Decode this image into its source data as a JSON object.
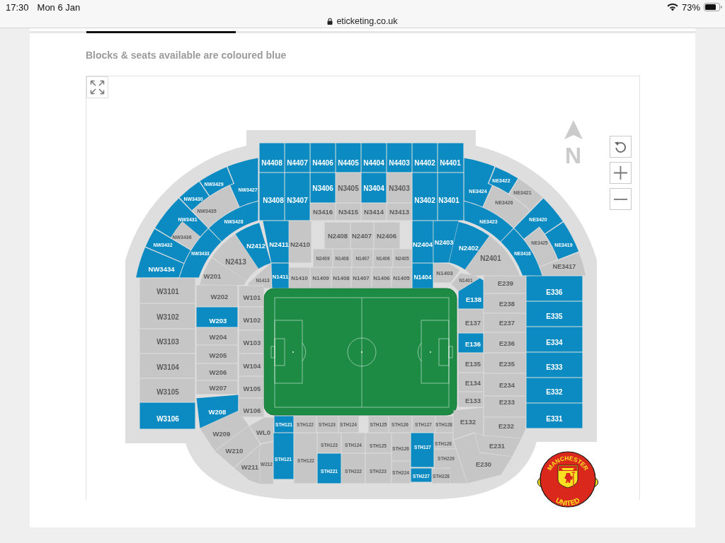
{
  "status_bar": {
    "time": "17:30",
    "date": "Mon 6 Jan",
    "battery": "73%"
  },
  "address_bar": {
    "url": "eticketing.co.uk"
  },
  "hint": "Blocks & seats available are coloured blue",
  "map": {
    "compass": "N",
    "blocks": [
      {
        "label": "N4408",
        "available": true
      },
      {
        "label": "N4407",
        "available": true
      },
      {
        "label": "N4406",
        "available": true
      },
      {
        "label": "N4405",
        "available": true
      },
      {
        "label": "N4404",
        "available": true
      },
      {
        "label": "N4403",
        "available": true
      },
      {
        "label": "N4402",
        "available": true
      },
      {
        "label": "N4401",
        "available": true
      },
      {
        "label": "NW3429",
        "available": true
      },
      {
        "label": "NE3422",
        "available": true
      },
      {
        "label": "NW3427",
        "available": true
      },
      {
        "label": "N3406",
        "available": true
      },
      {
        "label": "N3405",
        "available": false
      },
      {
        "label": "N3404",
        "available": true
      },
      {
        "label": "N3403",
        "available": false
      },
      {
        "label": "NE3424",
        "available": true
      },
      {
        "label": "NE3421",
        "available": false
      },
      {
        "label": "NW3430",
        "available": true
      },
      {
        "label": "N3408",
        "available": true
      },
      {
        "label": "N3407",
        "available": true
      },
      {
        "label": "N3402",
        "available": true
      },
      {
        "label": "N3401",
        "available": true
      },
      {
        "label": "NE3426",
        "available": false
      },
      {
        "label": "NW3435",
        "available": false
      },
      {
        "label": "N3416",
        "available": false
      },
      {
        "label": "N3415",
        "available": false
      },
      {
        "label": "N3414",
        "available": false
      },
      {
        "label": "N3413",
        "available": false
      },
      {
        "label": "NW3431",
        "available": true
      },
      {
        "label": "NW3428",
        "available": true
      },
      {
        "label": "NE3423",
        "available": true
      },
      {
        "label": "NE3420",
        "available": true
      },
      {
        "label": "NW3436",
        "available": false
      },
      {
        "label": "N2408",
        "available": false
      },
      {
        "label": "N2407",
        "available": false
      },
      {
        "label": "N2406",
        "available": false
      },
      {
        "label": "NW3432",
        "available": true
      },
      {
        "label": "N2412",
        "available": true
      },
      {
        "label": "N2411",
        "available": true
      },
      {
        "label": "N2410",
        "available": false
      },
      {
        "label": "N2404",
        "available": true
      },
      {
        "label": "N2403",
        "available": true
      },
      {
        "label": "N2402",
        "available": true
      },
      {
        "label": "NE3425",
        "available": false
      },
      {
        "label": "NE3419",
        "available": true
      },
      {
        "label": "NW3433",
        "available": true
      },
      {
        "label": "NE3418",
        "available": true
      },
      {
        "label": "N2413",
        "available": false
      },
      {
        "label": "N2409",
        "available": false
      },
      {
        "label": "N1408",
        "available": false
      },
      {
        "label": "N1407",
        "available": false
      },
      {
        "label": "N1406",
        "available": false
      },
      {
        "label": "N2405",
        "available": false
      },
      {
        "label": "N2401",
        "available": false
      },
      {
        "label": "NW3434",
        "available": true
      },
      {
        "label": "NE3417",
        "available": false
      },
      {
        "label": "W201",
        "available": false
      },
      {
        "label": "N1413",
        "available": false
      },
      {
        "label": "N1411",
        "available": true
      },
      {
        "label": "N1410",
        "available": false
      },
      {
        "label": "N1409",
        "available": false
      },
      {
        "label": "N1408",
        "available": false
      },
      {
        "label": "N1407",
        "available": false
      },
      {
        "label": "N1406",
        "available": false
      },
      {
        "label": "N1405",
        "available": false
      },
      {
        "label": "N1404",
        "available": true
      },
      {
        "label": "N1403",
        "available": false
      },
      {
        "label": "N1401",
        "available": false
      },
      {
        "label": "E239",
        "available": false
      },
      {
        "label": "W3101",
        "available": false
      },
      {
        "label": "W202",
        "available": false
      },
      {
        "label": "W101",
        "available": false
      },
      {
        "label": "E138",
        "available": true
      },
      {
        "label": "E336",
        "available": true
      },
      {
        "label": "E238",
        "available": false
      },
      {
        "label": "W3102",
        "available": false
      },
      {
        "label": "W203",
        "available": true
      },
      {
        "label": "W102",
        "available": false
      },
      {
        "label": "E137",
        "available": false
      },
      {
        "label": "E237",
        "available": false
      },
      {
        "label": "E335",
        "available": true
      },
      {
        "label": "W3103",
        "available": false
      },
      {
        "label": "W204",
        "available": false
      },
      {
        "label": "W103",
        "available": false
      },
      {
        "label": "E136",
        "available": true
      },
      {
        "label": "E236",
        "available": false
      },
      {
        "label": "E334",
        "available": true
      },
      {
        "label": "W205",
        "available": false
      },
      {
        "label": "W3104",
        "available": false
      },
      {
        "label": "W206",
        "available": false
      },
      {
        "label": "W104",
        "available": false
      },
      {
        "label": "E135",
        "available": false
      },
      {
        "label": "E235",
        "available": false
      },
      {
        "label": "E333",
        "available": true
      },
      {
        "label": "W3105",
        "available": false
      },
      {
        "label": "W207",
        "available": false
      },
      {
        "label": "W105",
        "available": false
      },
      {
        "label": "E134",
        "available": false
      },
      {
        "label": "E234",
        "available": false
      },
      {
        "label": "E332",
        "available": true
      },
      {
        "label": "E133",
        "available": false
      },
      {
        "label": "E233",
        "available": false
      },
      {
        "label": "W208",
        "available": true
      },
      {
        "label": "W106",
        "available": false
      },
      {
        "label": "W3106",
        "available": true
      },
      {
        "label": "STH121",
        "available": true
      },
      {
        "label": "STH122",
        "available": false
      },
      {
        "label": "STH123",
        "available": false
      },
      {
        "label": "STH124",
        "available": false
      },
      {
        "label": "STH125",
        "available": false
      },
      {
        "label": "STH126",
        "available": false
      },
      {
        "label": "STH127",
        "available": false
      },
      {
        "label": "STH128",
        "available": false
      },
      {
        "label": "E132",
        "available": false
      },
      {
        "label": "E232",
        "available": false
      },
      {
        "label": "E331",
        "available": true
      },
      {
        "label": "W209",
        "available": false
      },
      {
        "label": "WL0",
        "available": false
      },
      {
        "label": "W210",
        "available": false
      },
      {
        "label": "STH123",
        "available": false
      },
      {
        "label": "STH124",
        "available": false
      },
      {
        "label": "STH125",
        "available": false
      },
      {
        "label": "STH126",
        "available": false
      },
      {
        "label": "STH127",
        "available": true
      },
      {
        "label": "STH128",
        "available": false
      },
      {
        "label": "E231",
        "available": false
      },
      {
        "label": "W211",
        "available": false
      },
      {
        "label": "W212",
        "available": false
      },
      {
        "label": "STH121",
        "available": true
      },
      {
        "label": "STH122",
        "available": false
      },
      {
        "label": "STH229",
        "available": false
      },
      {
        "label": "E230",
        "available": false
      },
      {
        "label": "STH221",
        "available": true
      },
      {
        "label": "STH222",
        "available": false
      },
      {
        "label": "STH223",
        "available": false
      },
      {
        "label": "STH224",
        "available": false
      },
      {
        "label": "STH227",
        "available": true
      },
      {
        "label": "STH228",
        "available": false
      }
    ],
    "crest": {
      "top_text": "MANCHESTER",
      "bottom_text": "UNITED"
    }
  }
}
